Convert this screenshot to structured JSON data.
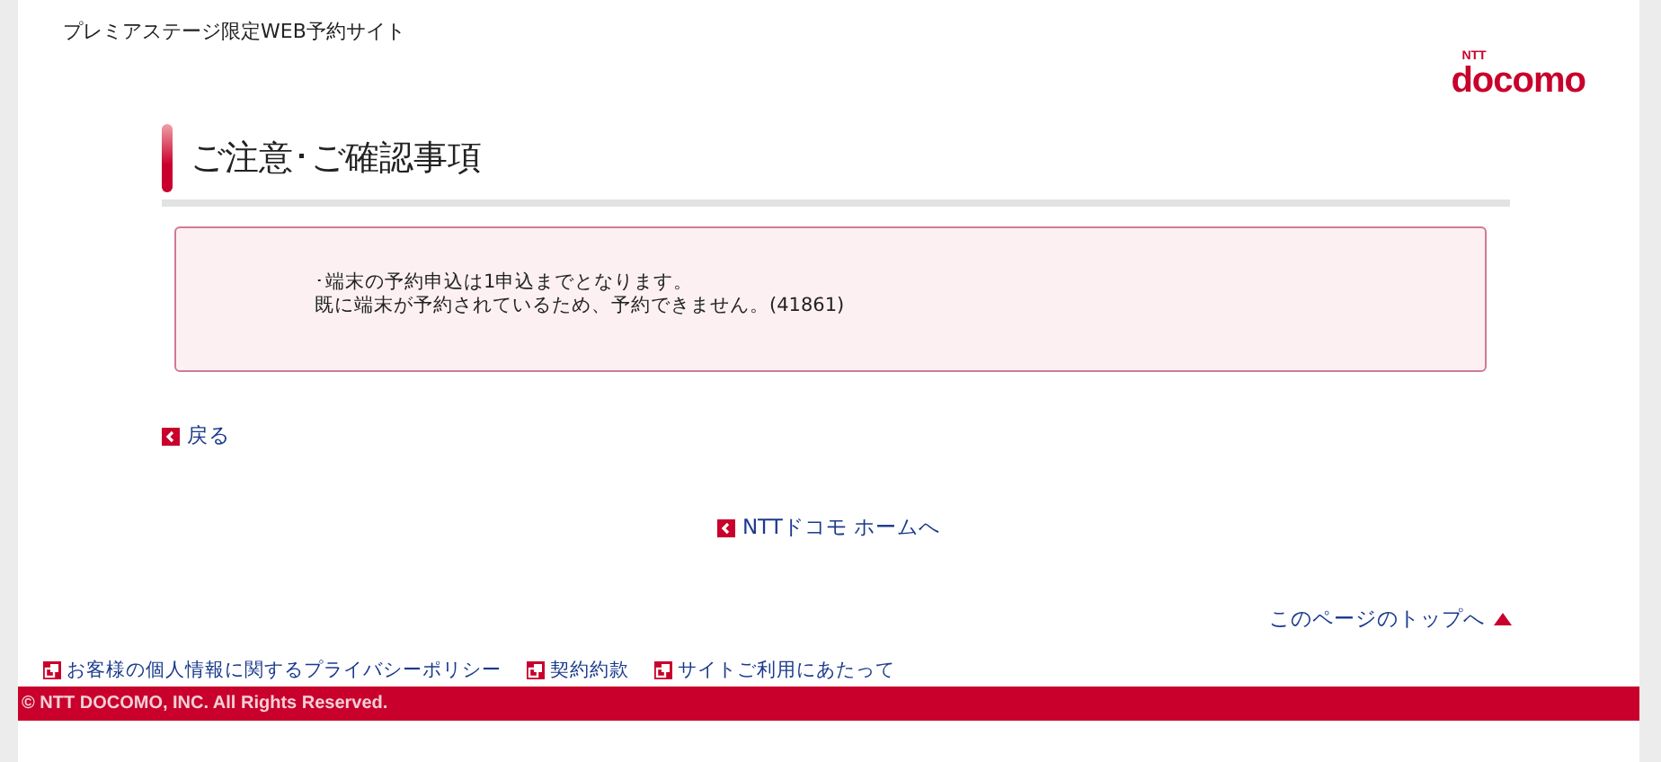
{
  "site_title": "プレミアステージ限定WEB予約サイト",
  "logo": {
    "brand": "NTT",
    "name": "docomo"
  },
  "heading": "ご注意･ご確認事項",
  "notice_lines": [
    "･端末の予約申込は1申込までとなります。",
    "既に端末が予約されているため、予約できません。(41861)"
  ],
  "back_link": "戻る",
  "home_link": "NTTドコモ ホームへ",
  "page_top_link": "このページのトップへ",
  "footer_links": [
    "お客様の個人情報に関するプライバシーポリシー",
    "契約約款",
    "サイトご利用にあたって"
  ],
  "copyright": "© NTT DOCOMO, INC. All Rights Reserved."
}
